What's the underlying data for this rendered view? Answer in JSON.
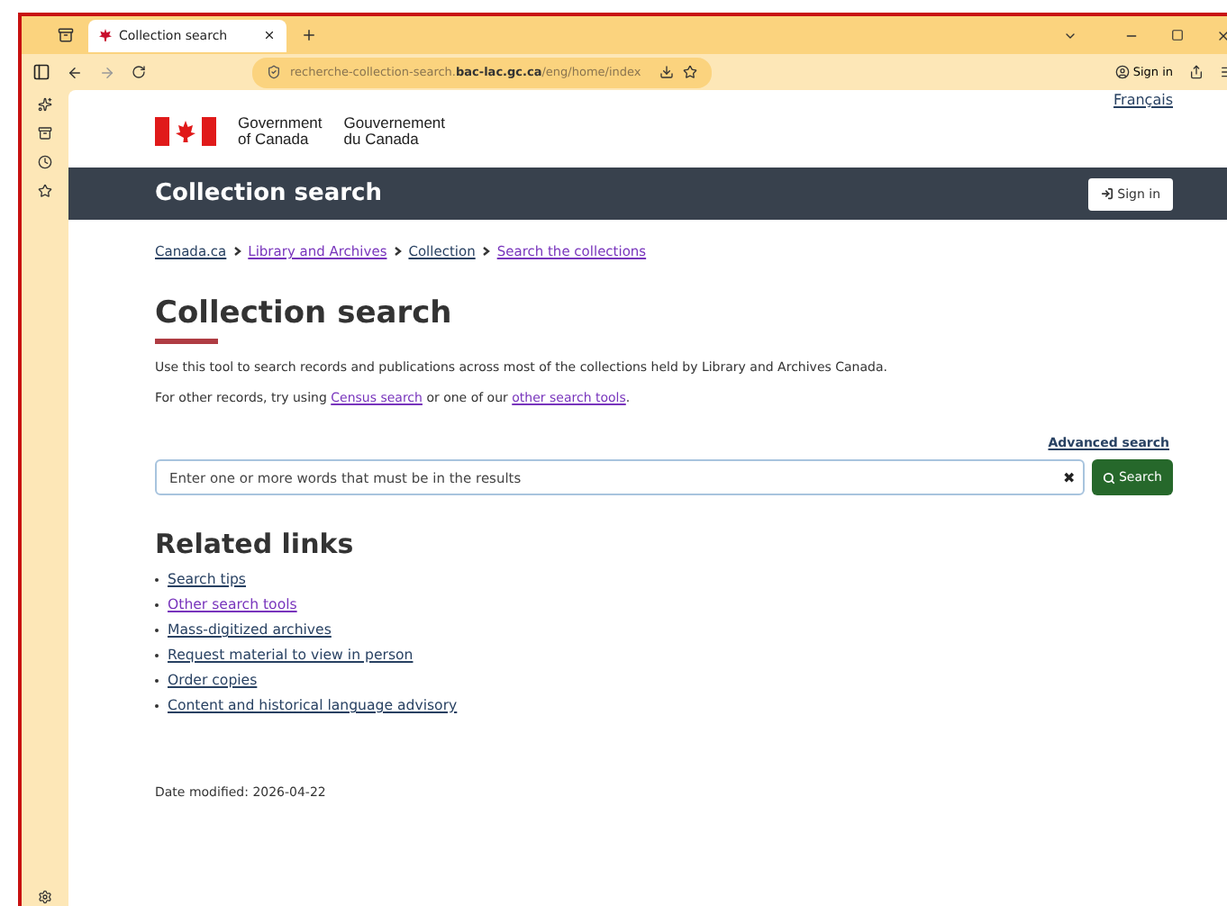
{
  "browser": {
    "tabs": [
      {
        "title": "Collection search",
        "selected": true
      }
    ],
    "address": {
      "host_prefix": "recherche-collection-search.",
      "host_main": "bac-lac.gc.ca",
      "path": "/eng/home/index"
    },
    "sign_in": "Sign in"
  },
  "header": {
    "language_link": "Français",
    "wordmark_en": [
      "Government",
      "of Canada"
    ],
    "wordmark_fr": [
      "Gouvernement",
      "du Canada"
    ]
  },
  "app_bar": {
    "title": "Collection search",
    "sign_in": "Sign in"
  },
  "breadcrumbs": [
    {
      "label": "Canada.ca",
      "visited": false
    },
    {
      "label": "Library and Archives",
      "visited": true
    },
    {
      "label": "Collection",
      "visited": false
    },
    {
      "label": "Search the collections",
      "visited": true
    }
  ],
  "heading": "Collection search",
  "intro": "Use this tool to search records and publications across most of the collections held by Library and Archives Canada.",
  "other": {
    "before": "For other records, try using ",
    "link1": {
      "label": "Census search",
      "visited": true
    },
    "middle": " or one of our ",
    "link2": {
      "label": "other search tools",
      "visited": true
    },
    "after": "."
  },
  "advanced_search": "Advanced search",
  "search": {
    "placeholder": "Enter one or more words that must be in the results",
    "clear": "✖",
    "button": "Search"
  },
  "related": {
    "heading": "Related links",
    "links": [
      {
        "label": "Search tips",
        "visited": false
      },
      {
        "label": "Other search tools",
        "visited": true
      },
      {
        "label": "Mass-digitized archives",
        "visited": false
      },
      {
        "label": "Request material to view in person",
        "visited": false
      },
      {
        "label": "Order copies",
        "visited": false
      },
      {
        "label": "Content and historical language advisory",
        "visited": false
      }
    ]
  },
  "date_modified": "Date modified: 2026-04-22"
}
